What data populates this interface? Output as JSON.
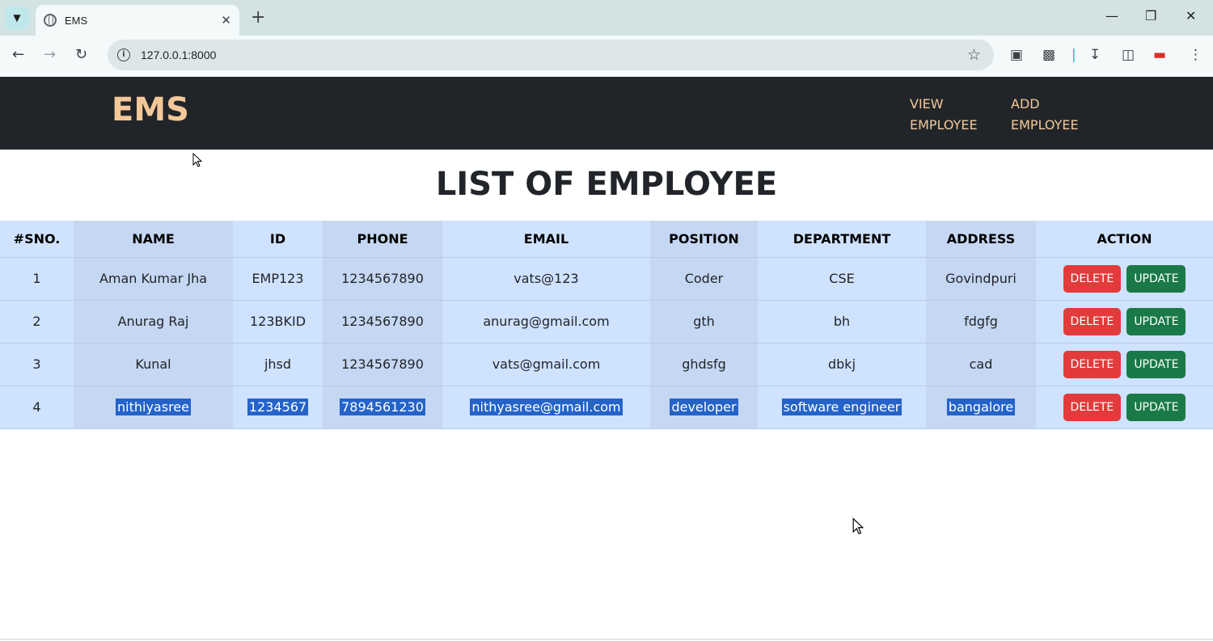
{
  "browser": {
    "tab_title": "EMS",
    "url": "127.0.0.1:8000"
  },
  "nav": {
    "brand": "EMS",
    "links": [
      {
        "label": "VIEW\nEMPLOYEE"
      },
      {
        "label": "ADD\nEMPLOYEE"
      }
    ]
  },
  "page": {
    "heading": "LIST OF EMPLOYEE"
  },
  "table": {
    "headers": [
      "#SNO.",
      "NAME",
      "ID",
      "PHONE",
      "EMAIL",
      "POSITION",
      "DEPARTMENT",
      "ADDRESS",
      "ACTION"
    ],
    "rows": [
      {
        "sno": "1",
        "name": "Aman Kumar Jha",
        "id": "EMP123",
        "phone": "1234567890",
        "email": "vats@123",
        "position": "Coder",
        "department": "CSE",
        "address": "Govindpuri"
      },
      {
        "sno": "2",
        "name": "Anurag Raj",
        "id": "123BKID",
        "phone": "1234567890",
        "email": "anurag@gmail.com",
        "position": "gth",
        "department": "bh",
        "address": "fdgfg"
      },
      {
        "sno": "3",
        "name": "Kunal",
        "id": "jhsd",
        "phone": "1234567890",
        "email": "vats@gmail.com",
        "position": "ghdsfg",
        "department": "dbkj",
        "address": "cad"
      },
      {
        "sno": "4",
        "name": "nithiyasree",
        "id": "1234567",
        "phone": "7894561230",
        "email": "nithyasree@gmail.com",
        "position": "developer",
        "department": "software engineer",
        "address": "bangalore"
      }
    ],
    "delete_label": "DELETE",
    "update_label": "UPDATE"
  },
  "colors": {
    "navbar_bg": "#212529",
    "brand_color": "#f3c899",
    "table_bg": "#cfe2ff",
    "delete_btn": "#e33b3b",
    "update_btn": "#1a7a47",
    "selection": "#2563c9"
  }
}
